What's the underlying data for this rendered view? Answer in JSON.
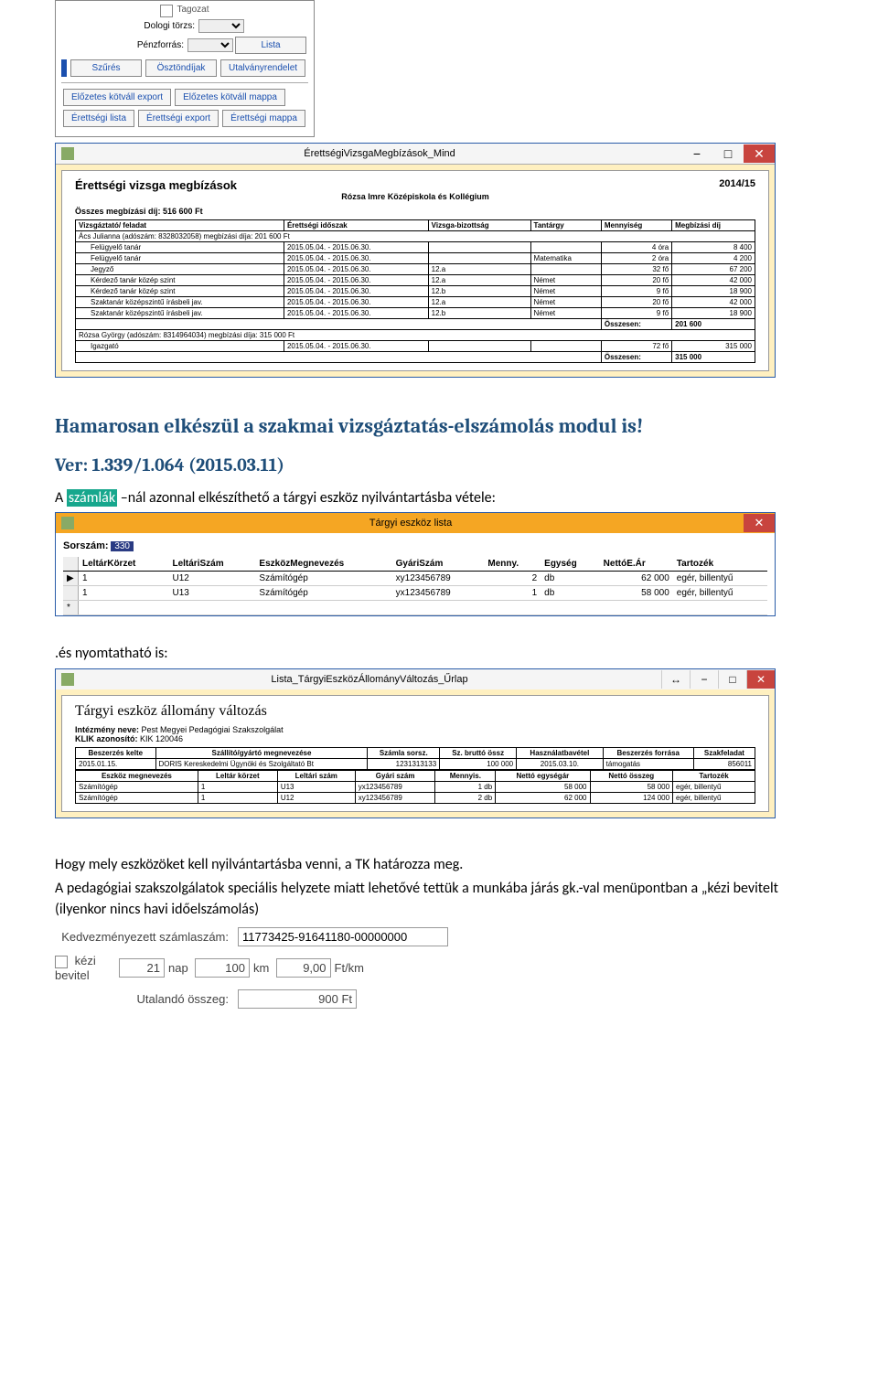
{
  "panel_top": {
    "checkbox_label": "Tagozat",
    "label_dologi": "Dologi törzs:",
    "label_penz": "Pénzforrás:",
    "btn_lista": "Lista",
    "btn_szures": "Szűrés",
    "btn_osztondij": "Ösztöndíjak",
    "btn_utalvany": "Utalványrendelet",
    "btn_elokotv_exp": "Előzetes kötváll export",
    "btn_elokotv_map": "Előzetes kötváll mappa",
    "btn_eretts_lista": "Érettségi lista",
    "btn_eretts_exp": "Érettségi export",
    "btn_eretts_map": "Érettségi mappa"
  },
  "report_window": {
    "title": "ÉrettségiVizsgaMegbízások_Mind",
    "heading": "Érettségi vizsga megbízások",
    "school_year": "2014/15",
    "school_name": "Rózsa Imre Középiskola és Kollégium",
    "sum_label": "Összes megbízási díj: 516 600 Ft",
    "cols": [
      "Vizsgáztató/ feladat",
      "Érettségi időszak",
      "Vizsga-bizottság",
      "Tantárgy",
      "Mennyiség",
      "Megbízási díj"
    ],
    "group1_head": "Ács Julianna (adószám: 8328032058) megbízási díja: 201 600 Ft",
    "group1_rows": [
      [
        "Felügyelő tanár",
        "2015.05.04. - 2015.06.30.",
        "",
        "",
        "4 óra",
        "8 400"
      ],
      [
        "Felügyelő tanár",
        "2015.05.04. - 2015.06.30.",
        "",
        "Matematika",
        "2 óra",
        "4 200"
      ],
      [
        "Jegyző",
        "2015.05.04. - 2015.06.30.",
        "12.a",
        "",
        "32 fő",
        "67 200"
      ],
      [
        "Kérdező tanár közép szint",
        "2015.05.04. - 2015.06.30.",
        "12.a",
        "Német",
        "20 fő",
        "42 000"
      ],
      [
        "Kérdező tanár közép szint",
        "2015.05.04. - 2015.06.30.",
        "12.b",
        "Német",
        "9 fő",
        "18 900"
      ],
      [
        "Szaktanár középszintű írásbeli jav.",
        "2015.05.04. - 2015.06.30.",
        "12.a",
        "Német",
        "20 fő",
        "42 000"
      ],
      [
        "Szaktanár középszintű írásbeli jav.",
        "2015.05.04. - 2015.06.30.",
        "12.b",
        "Német",
        "9 fő",
        "18 900"
      ]
    ],
    "group1_total_label": "Összesen:",
    "group1_total": "201 600",
    "group2_head": "Rózsa György (adószám: 8314964034) megbízási díja: 315 000 Ft",
    "group2_rows": [
      [
        "Igazgató",
        "2015.05.04. - 2015.06.30.",
        "",
        "",
        "72 fő",
        "315 000"
      ]
    ],
    "group2_total_label": "Összesen:",
    "group2_total": "315 000"
  },
  "doc": {
    "heading": "Hamarosan elkészül a szakmai vizsgáztatás-elszámolás modul is!",
    "ver": "Ver: 1.339/1.064  (2015.03.11)",
    "line1_pre": "A ",
    "line1_mark": "számlák",
    "line1_post": " –nál azonnal elkészíthető a tárgyi eszköz nyilvántartásba vétele:",
    "line2": ".és nyomtatható is:",
    "line3": "Hogy mely eszközöket kell nyilvántartásba venni, a TK határozza meg.",
    "line4": "A pedagógiai szakszolgálatok speciális helyzete miatt lehetővé tettük a munkába járás gk.-val menüpontban a „kézi bevitelt (ilyenkor nincs havi időelszámolás)"
  },
  "tel": {
    "title": "Tárgyi eszköz lista",
    "sorszam_label": "Sorszám:",
    "sorszam_val": "330",
    "cols": [
      "LeltárKörzet",
      "LeltáriSzám",
      "EszközMegnevezés",
      "GyáriSzám",
      "Menny.",
      "Egység",
      "NettóE.Ár",
      "Tartozék"
    ],
    "rows": [
      [
        "1",
        "U12",
        "Számítógép",
        "xy123456789",
        "2",
        "db",
        "62 000",
        "egér, billentyű"
      ],
      [
        "1",
        "U13",
        "Számítógép",
        "yx123456789",
        "1",
        "db",
        "58 000",
        "egér, billentyű"
      ]
    ]
  },
  "lt": {
    "title": "Lista_TárgyiEszközÁllományVáltozás_Űrlap",
    "heading": "Tárgyi eszköz állomány változás",
    "inst_label": "Intézmény neve:",
    "inst_val": "Pest Megyei Pedagógiai Szakszolgálat",
    "klik_label": "KLIK azonosító:",
    "klik_val": "KIK 120046",
    "t1_cols": [
      "Beszerzés kelte",
      "Szállító/gyártó megnevezése",
      "Számla sorsz.",
      "Sz. bruttó össz",
      "Használatbavétel",
      "Beszerzés forrása",
      "Szakfeladat"
    ],
    "t1_row": [
      "2015.01.15.",
      "DORIS Kereskedelmi Ügynöki és Szolgáltató Bt",
      "1231313133",
      "100 000",
      "2015.03.10.",
      "támogatás",
      "856011"
    ],
    "t2_cols": [
      "Eszköz megnevezés",
      "Leltár körzet",
      "Leltári szám",
      "Gyári szám",
      "Mennyis.",
      "Nettó egységár",
      "Nettó összeg",
      "Tartozék"
    ],
    "t2_rows": [
      [
        "Számítógép",
        "1",
        "U13",
        "yx123456789",
        "1 db",
        "58 000",
        "58 000",
        "egér, billentyű"
      ],
      [
        "Számítógép",
        "1",
        "U12",
        "xy123456789",
        "2 db",
        "62 000",
        "124 000",
        "egér, billentyű"
      ]
    ]
  },
  "bottom": {
    "lbl_kedv": "Kedvezményezett számlaszám:",
    "val_kedv": "11773425-91641180-00000000",
    "lbl_kezi": "kézi bevitel",
    "nap": "21",
    "nap_suf": "nap",
    "km": "100",
    "km_suf": "km",
    "rate": "9,00",
    "rate_suf": "Ft/km",
    "lbl_utal": "Utalandó összeg:",
    "val_utal": "900 Ft"
  }
}
